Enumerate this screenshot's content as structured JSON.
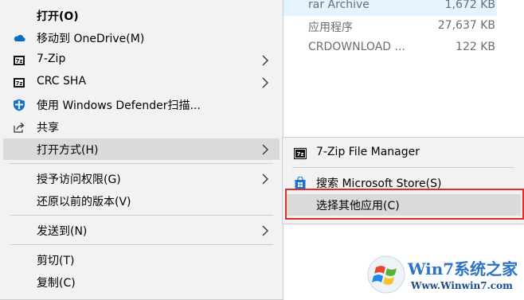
{
  "files": [
    {
      "type": "rar Archive",
      "size": "1,672 KB"
    },
    {
      "type": "应用程序",
      "size": "27,637 KB"
    },
    {
      "type": "CRDOWNLOAD ...",
      "size": "122 KB"
    }
  ],
  "main_menu": {
    "open": "打开(O)",
    "onedrive": "移动到 OneDrive(M)",
    "zip": "7-Zip",
    "crc": "CRC SHA",
    "defender": "使用 Windows Defender扫描...",
    "share": "共享",
    "open_with": "打开方式(H)",
    "grant_access": "授予访问权限(G)",
    "restore": "还原以前的版本(V)",
    "send_to": "发送到(N)",
    "cut": "剪切(T)",
    "copy": "复制(C)"
  },
  "sub_menu": {
    "zip_fm": "7-Zip File Manager",
    "store": "搜索 Microsoft Store(S)",
    "choose": "选择其他应用(C)"
  },
  "watermark": {
    "brand": "Win7系统之家",
    "url": "Www.Winwin7.com"
  },
  "colors": {
    "menu_bg": "#f2f2f2",
    "hover_bg": "#dadada",
    "highlight_border": "#e32b2b",
    "onedrive": "#0f6cbd"
  }
}
